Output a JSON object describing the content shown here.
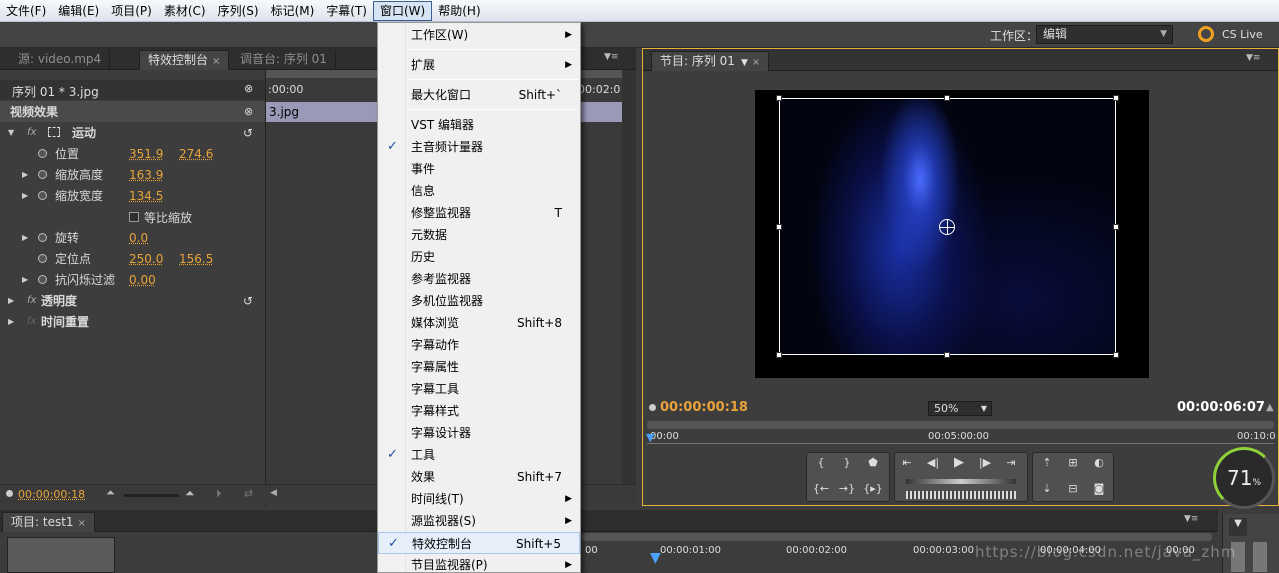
{
  "menubar": [
    "文件(F)",
    "编辑(E)",
    "项目(P)",
    "素材(C)",
    "序列(S)",
    "标记(M)",
    "字幕(T)",
    "窗口(W)",
    "帮助(H)"
  ],
  "workspace": {
    "label": "工作区：",
    "value": "编辑",
    "cslive": "CS Live"
  },
  "left_tabs": {
    "source": "源: video.mp4",
    "effects_control": "特效控制台",
    "mixer": "调音台: 序列 01"
  },
  "effects": {
    "clip_path": "序列 01 * 3.jpg",
    "timeline_tc": ":00:00",
    "timeline_tc2": "00:02:0",
    "clip_name": "3.jpg",
    "video_effects": "视频效果",
    "motion": "运动",
    "position": {
      "label": "位置",
      "x": "351.9",
      "y": "274.6"
    },
    "scale_h": {
      "label": "缩放高度",
      "v": "163.9"
    },
    "scale_w": {
      "label": "缩放宽度",
      "v": "134.5"
    },
    "uniform": "等比缩放",
    "rotation": {
      "label": "旋转",
      "v": "0.0"
    },
    "anchor": {
      "label": "定位点",
      "x": "250.0",
      "y": "156.5"
    },
    "antiflicker": {
      "label": "抗闪烁过滤",
      "v": "0.00"
    },
    "opacity": "透明度",
    "time_remap": "时间重置",
    "bottom_tc": "00:00:00:18"
  },
  "menu": {
    "items": [
      {
        "label": "工作区(W)",
        "shortcut": "",
        "submenu": true,
        "checked": false
      },
      {
        "label": "扩展",
        "shortcut": "",
        "submenu": true,
        "checked": false
      },
      {
        "label": "最大化窗口",
        "shortcut": "Shift+`",
        "submenu": false,
        "checked": false
      },
      {
        "label": "VST 编辑器",
        "shortcut": "",
        "submenu": false,
        "checked": false
      },
      {
        "label": "主音频计量器",
        "shortcut": "",
        "submenu": false,
        "checked": true
      },
      {
        "label": "事件",
        "shortcut": "",
        "submenu": false,
        "checked": false
      },
      {
        "label": "信息",
        "shortcut": "",
        "submenu": false,
        "checked": false
      },
      {
        "label": "修整监视器",
        "shortcut": "T",
        "submenu": false,
        "checked": false
      },
      {
        "label": "元数据",
        "shortcut": "",
        "submenu": false,
        "checked": false
      },
      {
        "label": "历史",
        "shortcut": "",
        "submenu": false,
        "checked": false
      },
      {
        "label": "参考监视器",
        "shortcut": "",
        "submenu": false,
        "checked": false
      },
      {
        "label": "多机位监视器",
        "shortcut": "",
        "submenu": false,
        "checked": false
      },
      {
        "label": "媒体浏览",
        "shortcut": "Shift+8",
        "submenu": false,
        "checked": false
      },
      {
        "label": "字幕动作",
        "shortcut": "",
        "submenu": false,
        "checked": false
      },
      {
        "label": "字幕属性",
        "shortcut": "",
        "submenu": false,
        "checked": false
      },
      {
        "label": "字幕工具",
        "shortcut": "",
        "submenu": false,
        "checked": false
      },
      {
        "label": "字幕样式",
        "shortcut": "",
        "submenu": false,
        "checked": false
      },
      {
        "label": "字幕设计器",
        "shortcut": "",
        "submenu": false,
        "checked": false
      },
      {
        "label": "工具",
        "shortcut": "",
        "submenu": false,
        "checked": true
      },
      {
        "label": "效果",
        "shortcut": "Shift+7",
        "submenu": false,
        "checked": false
      },
      {
        "label": "时间线(T)",
        "shortcut": "",
        "submenu": true,
        "checked": false
      },
      {
        "label": "源监视器(S)",
        "shortcut": "",
        "submenu": true,
        "checked": false
      },
      {
        "label": "特效控制台",
        "shortcut": "Shift+5",
        "submenu": false,
        "checked": true
      },
      {
        "label": "节目监视器(P)",
        "shortcut": "",
        "submenu": true,
        "checked": false
      }
    ]
  },
  "program": {
    "tab": "节目: 序列 01",
    "tc_current": "00:00:00:18",
    "zoom": "50%",
    "tc_duration": "00:00:06:07",
    "ruler_start": "00:00",
    "ruler_mid": "00:05:00:00",
    "ruler_end": "00:10:0"
  },
  "meter_value": "71",
  "meter_unit": "%",
  "project": {
    "tab": "项目: test1",
    "ruler": [
      "00",
      "00:00:01:00",
      "00:00:02:00",
      "00:00:03:00",
      "00:00:04:00",
      "00:00"
    ]
  },
  "watermark": "https://blog.csdn.net/java_zhm"
}
